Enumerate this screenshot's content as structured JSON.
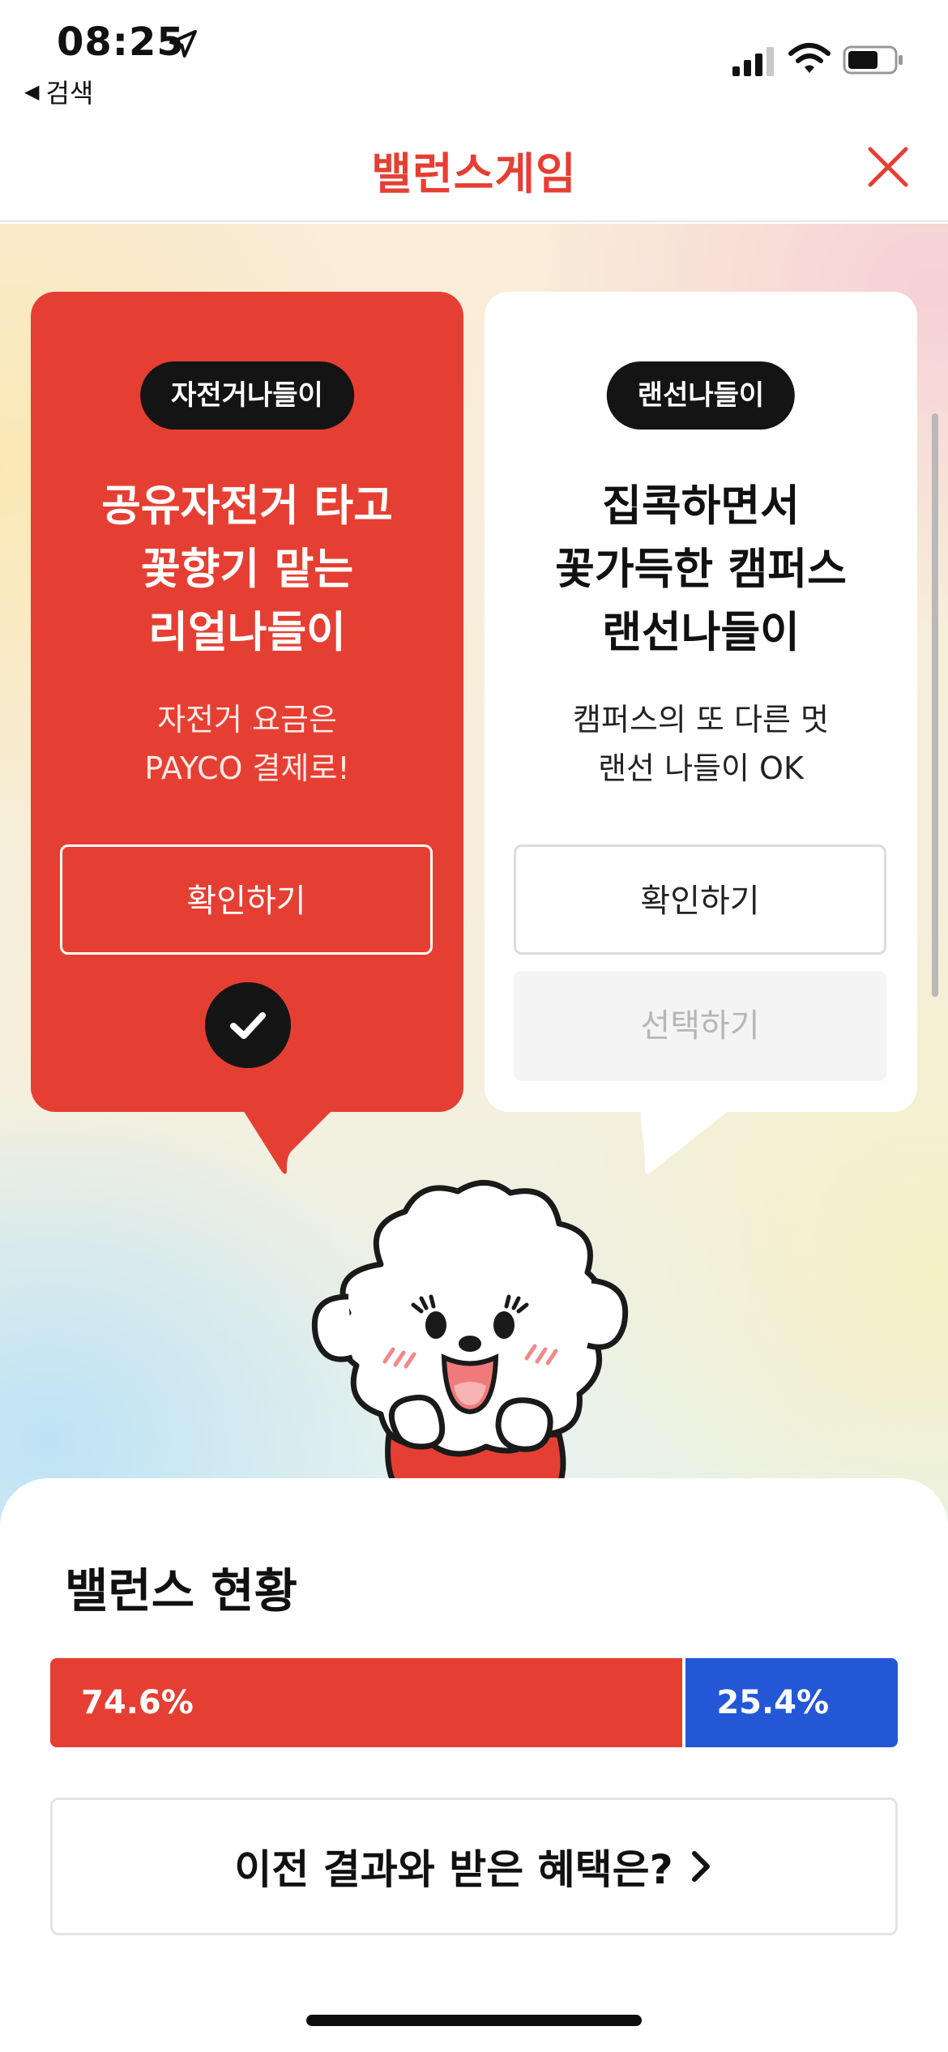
{
  "status_bar": {
    "time": "08:25",
    "back_label": "검색"
  },
  "header": {
    "title": "밸런스게임"
  },
  "cards": {
    "left": {
      "tag": "자전거나들이",
      "title_lines": [
        "공유자전거 타고",
        "꽃향기 맡는",
        "리얼나들이"
      ],
      "desc_lines": [
        "자전거 요금은",
        "PAYCO 결제로!"
      ],
      "confirm_label": "확인하기",
      "selected": true
    },
    "right": {
      "tag": "랜선나들이",
      "title_lines": [
        "집콕하면서",
        "꽃가득한 캠퍼스",
        "랜선나들이"
      ],
      "desc_lines": [
        "캠퍼스의 또 다른 멋",
        "랜선 나들이 OK"
      ],
      "confirm_label": "확인하기",
      "select_label": "선택하기",
      "selected": false
    }
  },
  "balance": {
    "title": "밸런스 현황",
    "left_percent": 74.6,
    "right_percent": 25.4,
    "left_label": "74.6%",
    "right_label": "25.4%",
    "left_color": "#e53f33",
    "right_color": "#2457d6"
  },
  "history_button": {
    "label": "이전 결과와 받은 혜택은?"
  },
  "colors": {
    "accent": "#e53f33",
    "blue": "#2457d6"
  },
  "icons": [
    "location-arrow-icon",
    "back-triangle-icon",
    "signal-icon",
    "wifi-icon",
    "battery-icon",
    "close-icon",
    "check-icon",
    "chevron-right-icon"
  ]
}
